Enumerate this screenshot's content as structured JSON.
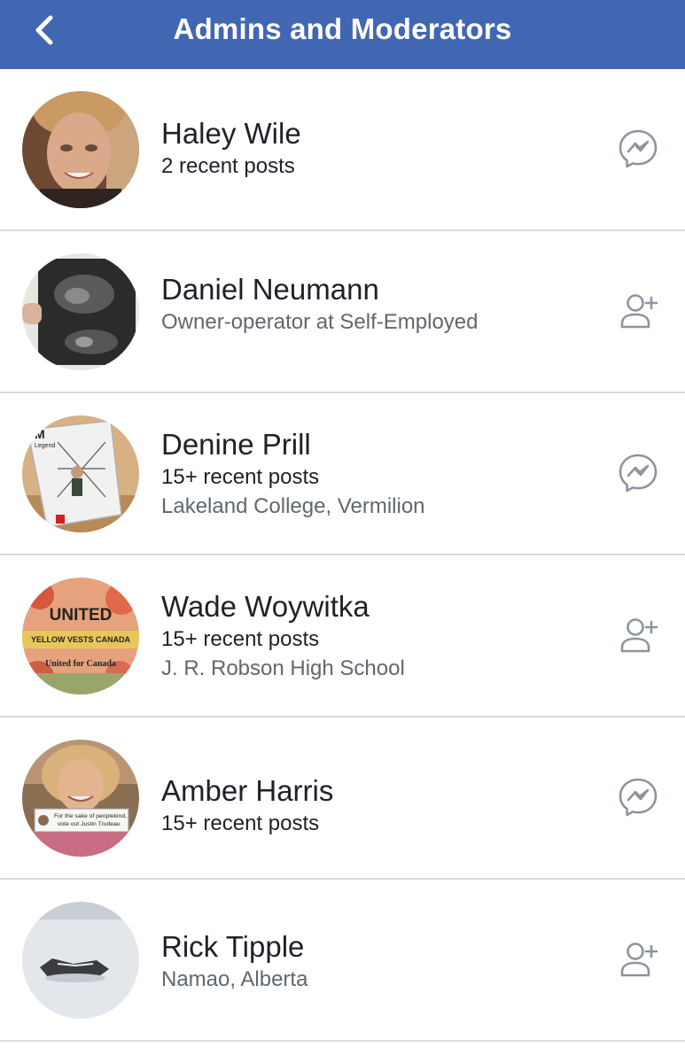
{
  "header": {
    "title": "Admins and Moderators"
  },
  "colors": {
    "header_bg": "#4267b2",
    "divider": "#d8dade",
    "icon_gray": "#8d949e"
  },
  "members": [
    {
      "name": "Haley Wile",
      "line1": "2 recent posts",
      "line2": "",
      "action_icon": "messenger-icon"
    },
    {
      "name": "Daniel Neumann",
      "line1": "Owner-operator at Self-Employed",
      "line2": "",
      "action_icon": "add-friend-icon"
    },
    {
      "name": "Denine Prill",
      "line1": "15+ recent posts",
      "line2": "Lakeland College, Vermilion",
      "action_icon": "messenger-icon",
      "avatar_text": "Legend"
    },
    {
      "name": "Wade Woywitka",
      "line1": "15+ recent posts",
      "line2": "J. R. Robson High School",
      "action_icon": "add-friend-icon",
      "avatar_text": {
        "line1": "UNITED",
        "line2": "YELLOW VESTS CANADA",
        "line3": "United for Canada"
      }
    },
    {
      "name": "Amber Harris",
      "line1": "15+ recent posts",
      "line2": "",
      "action_icon": "messenger-icon",
      "avatar_text": {
        "line1": "For the sake of peoplekind,",
        "line2": "vote out Justin Trudeau"
      }
    },
    {
      "name": "Rick Tipple",
      "line1": "Namao, Alberta",
      "line2": "",
      "action_icon": "add-friend-icon"
    }
  ]
}
